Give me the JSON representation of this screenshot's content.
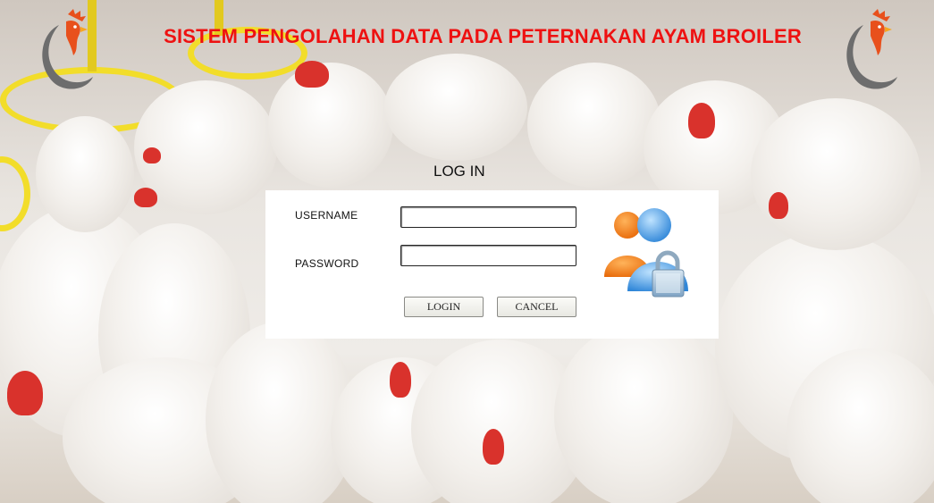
{
  "header": {
    "title": "SISTEM PENGOLAHAN DATA PADA PETERNAKAN AYAM BROILER",
    "title_color": "#ee1111"
  },
  "logos": {
    "left": "rooster-logo-icon",
    "right": "rooster-logo-icon"
  },
  "login": {
    "heading": "LOG IN",
    "username_label": "USERNAME",
    "password_label": "PASSWORD",
    "username_value": "",
    "password_value": "",
    "login_button": "LOGIN",
    "cancel_button": "CANCEL",
    "icon": "users-lock-icon"
  },
  "background": {
    "description_icon": "broiler-chickens-background-image"
  }
}
